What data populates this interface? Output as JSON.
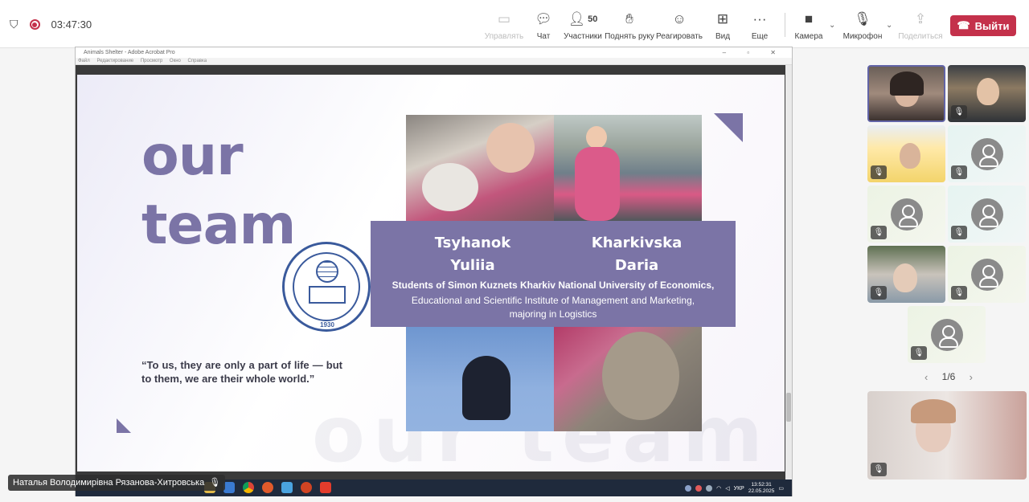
{
  "meeting": {
    "timer": "03:47:30"
  },
  "toolbar": {
    "control_label": "Управлять",
    "chat_label": "Чат",
    "participants_label": "Участники",
    "participants_count": "50",
    "raise_hand_label": "Поднять руку",
    "react_label": "Реагировать",
    "view_label": "Вид",
    "more_label": "Еще",
    "camera_label": "Камера",
    "mic_label": "Микрофон",
    "share_label": "Поделиться",
    "leave_label": "Выйти"
  },
  "shared_window": {
    "title": "Animals Shelter - Adobe Acrobat Pro",
    "menu": [
      "Файл",
      "Редактирование",
      "Просмотр",
      "Окно",
      "Справка"
    ]
  },
  "slide": {
    "title_line1": "our",
    "title_line2": "team",
    "watermark": "our team",
    "seal_year": "1930",
    "person1_first": "Tsyhanok",
    "person1_last": "Yuliia",
    "person2_first": "Kharkivska",
    "person2_last": "Daria",
    "band_line1": "Students of Simon Kuznets Kharkiv National University of Economics,",
    "band_line2": "Educational and Scientific Institute of Management and Marketing,",
    "band_line3": "majoring in Logistics",
    "quote": "“To us, they are only a part of life — but to them, we are their whole world.”"
  },
  "taskbar": {
    "lang": "УКР",
    "time": "13:52:31",
    "date": "22.05.2025"
  },
  "presenter": {
    "name": "Наталья Володимирівна Рязанова-Хитровська"
  },
  "gallery": {
    "pager": "1/6"
  },
  "colors": {
    "accent": "#6264a7",
    "leave": "#c4314b",
    "slide_purple": "#7b74a6"
  }
}
